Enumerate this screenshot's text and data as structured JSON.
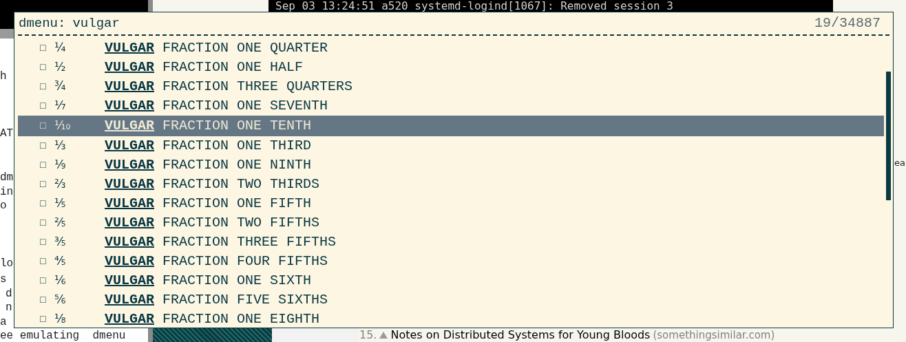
{
  "terminal": {
    "line": "Sep 03 13:24:51 a520 systemd-logind[1067]: Removed session 3"
  },
  "left_pane": {
    "lines": [
      "h",
      "AT",
      "dm",
      "in",
      "o",
      "lo",
      "s",
      "d",
      "n",
      "a",
      "ee emulating  dmenu"
    ]
  },
  "hn": {
    "right_fragment": "ea",
    "bottom_item": {
      "rank": "15.",
      "title": "Notes on Distributed Systems for Young Bloods",
      "site": "(somethingsimilar.com)"
    }
  },
  "dmenu": {
    "prompt": "dmenu:",
    "query": "vulgar",
    "counter": "19/34887",
    "items": [
      {
        "box": "□",
        "glyph": "¼",
        "name": "**VULGAR** FRACTION ONE QUARTER",
        "selected": false
      },
      {
        "box": "□",
        "glyph": "½",
        "name": "**VULGAR** FRACTION ONE HALF",
        "selected": false
      },
      {
        "box": "□",
        "glyph": "¾",
        "name": "**VULGAR** FRACTION THREE QUARTERS",
        "selected": false
      },
      {
        "box": "□",
        "glyph": "⅐",
        "name": "**VULGAR** FRACTION ONE SEVENTH",
        "selected": false
      },
      {
        "box": "□",
        "glyph": "⅒",
        "name": "**VULGAR** FRACTION ONE TENTH",
        "selected": true
      },
      {
        "box": "□",
        "glyph": "⅓",
        "name": "**VULGAR** FRACTION ONE THIRD",
        "selected": false
      },
      {
        "box": "□",
        "glyph": "⅑",
        "name": "**VULGAR** FRACTION ONE NINTH",
        "selected": false
      },
      {
        "box": "□",
        "glyph": "⅔",
        "name": "**VULGAR** FRACTION TWO THIRDS",
        "selected": false
      },
      {
        "box": "□",
        "glyph": "⅕",
        "name": "**VULGAR** FRACTION ONE FIFTH",
        "selected": false
      },
      {
        "box": "□",
        "glyph": "⅖",
        "name": "**VULGAR** FRACTION TWO FIFTHS",
        "selected": false
      },
      {
        "box": "□",
        "glyph": "⅗",
        "name": "**VULGAR** FRACTION THREE FIFTHS",
        "selected": false
      },
      {
        "box": "□",
        "glyph": "⅘",
        "name": "**VULGAR** FRACTION FOUR FIFTHS",
        "selected": false
      },
      {
        "box": "□",
        "glyph": "⅙",
        "name": "**VULGAR** FRACTION ONE SIXTH",
        "selected": false
      },
      {
        "box": "□",
        "glyph": "⅚",
        "name": "**VULGAR** FRACTION FIVE SIXTHS",
        "selected": false
      },
      {
        "box": "□",
        "glyph": "⅛",
        "name": "**VULGAR** FRACTION ONE EIGHTH",
        "selected": false
      }
    ]
  }
}
